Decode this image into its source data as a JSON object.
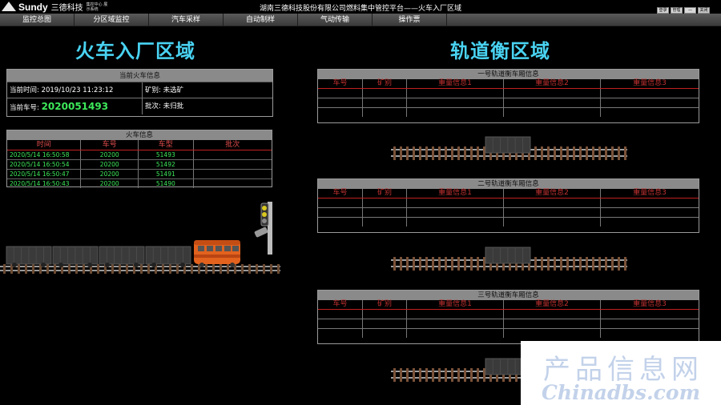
{
  "app": {
    "brand_name": "Sundy",
    "brand_cn": "三德科技",
    "brand_sub": "集控中心 展示系统",
    "title": "湖南三德科技股份有限公司燃料集中管控平台——火车入厂区域",
    "window_buttons": [
      "登录",
      "管理",
      "—",
      "关闭"
    ]
  },
  "menu": [
    "监控总图",
    "分区域监控",
    "汽车采样",
    "自动制样",
    "气动传输",
    "操作票"
  ],
  "left": {
    "title": "火车入厂区域",
    "current_train": {
      "header": "当前火车信息",
      "time_label": "当前时间:",
      "time_value": "2019/10/23 11:23:12",
      "ore_label": "矿别:",
      "ore_value": "未选矿",
      "number_label": "当前车号:",
      "number_value": "2020051493",
      "batch_label": "批次:",
      "batch_value": "未归批"
    },
    "train_info": {
      "header": "火车信息",
      "columns": [
        "时间",
        "车号",
        "车型",
        "批次"
      ],
      "rows": [
        [
          "2020/5/14 16:50:58",
          "20200",
          "51493",
          ""
        ],
        [
          "2020/5/14 16:50:54",
          "20200",
          "51492",
          ""
        ],
        [
          "2020/5/14 16:50:47",
          "20200",
          "51491",
          ""
        ],
        [
          "2020/5/14 16:50:43",
          "20200",
          "51490",
          ""
        ]
      ]
    }
  },
  "right": {
    "title": "轨道衡区域",
    "tracks": [
      {
        "header": "一号轨道衡车厢信息"
      },
      {
        "header": "二号轨道衡车厢信息"
      },
      {
        "header": "三号轨道衡车厢信息"
      }
    ],
    "columns": [
      "车号",
      "矿别",
      "重量信息1",
      "重量信息2",
      "重量信息3"
    ]
  },
  "watermark": {
    "line1": "产品信息网",
    "line2": "Chinadbs.com"
  },
  "colors": {
    "accent": "#49d3f2",
    "green": "#3de85a",
    "red": "#c03030",
    "loco": "#e2621e"
  }
}
